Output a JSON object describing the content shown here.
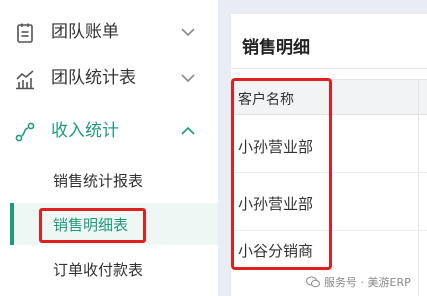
{
  "sidebar": {
    "items": [
      {
        "label": "团队账单"
      },
      {
        "label": "团队统计表"
      },
      {
        "label": "收入统计"
      }
    ],
    "sub_items": [
      {
        "label": "销售统计报表"
      },
      {
        "label": "销售明细表"
      },
      {
        "label": "订单收付款表"
      }
    ]
  },
  "main": {
    "title": "销售明细",
    "table": {
      "headers": [
        "客户名称"
      ],
      "rows": [
        [
          "小孙营业部"
        ],
        [
          "小孙营业部"
        ],
        [
          "小谷分销商"
        ]
      ]
    }
  },
  "watermark": {
    "text": "服务号 · 美游ERP"
  },
  "colors": {
    "accent": "#1f9b7a",
    "highlight": "#e02020"
  },
  "icons": {
    "menu0": "bill-icon",
    "menu1": "bar-chart-icon",
    "menu2": "revenue-icon"
  }
}
